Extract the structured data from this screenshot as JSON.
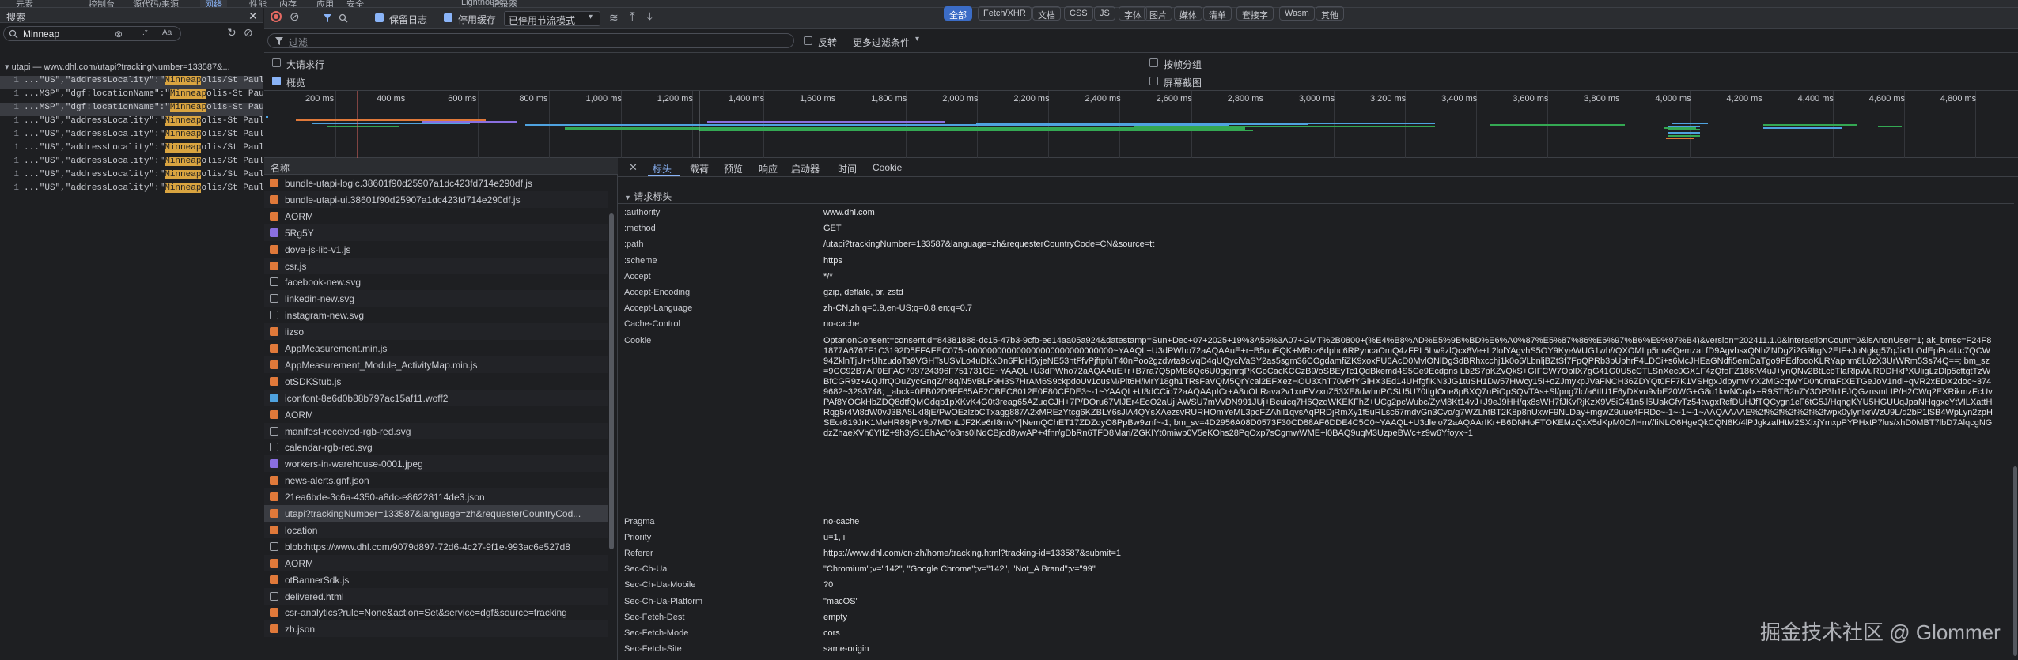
{
  "top_tabs": [
    "元素",
    "控制台",
    "源代码/来源",
    "网络",
    "性能",
    "内存",
    "应用",
    "安全",
    "Lighthouse",
    "记录器"
  ],
  "left_panel": {
    "title": "搜索",
    "query": "Minneap",
    "opts": [
      "Aa",
      ".*"
    ],
    "results_group": "utapi — www.dhl.com/utapi?trackingNumber=133587&...",
    "results": [
      {
        "n": "1",
        "pre": "...\"US\",\"addressLocality\":\"",
        "hl": "Minneap",
        "post": "olis/St Paul Apt\"},..."
      },
      {
        "n": "1",
        "pre": "...MSP\",\"dgf:locationName\":\"",
        "hl": "Minneap",
        "post": "olis-St Paul Int..."
      },
      {
        "n": "1",
        "pre": "...MSP\",\"dgf:locationName\":\"",
        "hl": "Minneap",
        "post": "olis-St Paul Int..."
      },
      {
        "n": "1",
        "pre": "...\"US\",\"addressLocality\":\"",
        "hl": "Minneap",
        "post": "olis-St Paul Inter..."
      },
      {
        "n": "1",
        "pre": "...\"US\",\"addressLocality\":\"",
        "hl": "Minneap",
        "post": "olis/St Paul Apt\"},..."
      },
      {
        "n": "1",
        "pre": "...\"US\",\"addressLocality\":\"",
        "hl": "Minneap",
        "post": "olis/St Paul Apt\"},..."
      },
      {
        "n": "1",
        "pre": "...\"US\",\"addressLocality\":\"",
        "hl": "Minneap",
        "post": "olis/St Paul Apt\"},..."
      },
      {
        "n": "1",
        "pre": "...\"US\",\"addressLocality\":\"",
        "hl": "Minneap",
        "post": "olis/St Paul Apt\"},..."
      },
      {
        "n": "1",
        "pre": "...\"US\",\"addressLocality\":\"",
        "hl": "Minneap",
        "post": "olis/St Paul Apt\"},..."
      }
    ]
  },
  "toolbar": {
    "preserve_log": "保留日志",
    "disable_cache": "停用缓存",
    "throttle": "已停用节流模式"
  },
  "filter": {
    "placeholder": "过滤",
    "invert": "反转",
    "more": "更多过滤条件",
    "types": [
      "全部",
      "Fetch/XHR",
      "文档",
      "CSS",
      "JS",
      "字体",
      "图片",
      "媒体",
      "清单",
      "套接字",
      "Wasm",
      "其他"
    ]
  },
  "options": {
    "big_rows": "大请求行",
    "overview": "概览",
    "group_by_frame": "按帧分组",
    "screenshots": "屏幕截图"
  },
  "timeline": {
    "ticks": [
      "200 ms",
      "400 ms",
      "600 ms",
      "800 ms",
      "1,000 ms",
      "1,200 ms",
      "1,400 ms",
      "1,600 ms",
      "1,800 ms",
      "2,000 ms",
      "2,200 ms",
      "2,400 ms",
      "2,600 ms",
      "2,800 ms",
      "3,000 ms",
      "3,200 ms",
      "3,400 ms",
      "3,600 ms",
      "3,800 ms",
      "4,000 ms",
      "4,200 ms",
      "4,400 ms",
      "4,600 ms",
      "4,800 ms"
    ]
  },
  "list_header": "名称",
  "requests": [
    {
      "name": "bundle-utapi-logic.38601f90d25907a1dc423fd714e290df.js",
      "type": "js"
    },
    {
      "name": "bundle-utapi-ui.38601f90d25907a1dc423fd714e290df.js",
      "type": "js"
    },
    {
      "name": "AORM",
      "type": "xhr"
    },
    {
      "name": "5Rg5Y",
      "type": "img"
    },
    {
      "name": "dove-js-lib-v1.js",
      "type": "js"
    },
    {
      "name": "csr.js",
      "type": "js"
    },
    {
      "name": "facebook-new.svg",
      "type": "svg"
    },
    {
      "name": "linkedin-new.svg",
      "type": "svg"
    },
    {
      "name": "instagram-new.svg",
      "type": "svg"
    },
    {
      "name": "iizso",
      "type": "js"
    },
    {
      "name": "AppMeasurement.min.js",
      "type": "js"
    },
    {
      "name": "AppMeasurement_Module_ActivityMap.min.js",
      "type": "js"
    },
    {
      "name": "otSDKStub.js",
      "type": "js"
    },
    {
      "name": "iconfont-8e6d0b88b797ac15af11.woff2",
      "type": "font"
    },
    {
      "name": "AORM",
      "type": "xhr"
    },
    {
      "name": "manifest-received-rgb-red.svg",
      "type": "svg"
    },
    {
      "name": "calendar-rgb-red.svg",
      "type": "svg"
    },
    {
      "name": "workers-in-warehouse-0001.jpeg",
      "type": "img"
    },
    {
      "name": "news-alerts.gnf.json",
      "type": "xhr"
    },
    {
      "name": "21ea6bde-3c6a-4350-a8dc-e86228114de3.json",
      "type": "xhr"
    },
    {
      "name": "utapi?trackingNumber=133587&language=zh&requesterCountryCod...",
      "type": "xhr"
    },
    {
      "name": "location",
      "type": "xhr"
    },
    {
      "name": "blob:https://www.dhl.com/9079d897-72d6-4c27-9f1e-993ac6e527d8",
      "type": "doc"
    },
    {
      "name": "AORM",
      "type": "xhr"
    },
    {
      "name": "otBannerSdk.js",
      "type": "js"
    },
    {
      "name": "delivered.html",
      "type": "doc"
    },
    {
      "name": "csr-analytics?rule=None&action=Set&service=dgf&source=tracking",
      "type": "xhr"
    },
    {
      "name": "zh.json",
      "type": "xhr"
    }
  ],
  "details": {
    "tabs": [
      "标头",
      "载荷",
      "预览",
      "响应",
      "启动器",
      "时间",
      "Cookie"
    ],
    "section": "请求标头",
    "headers": [
      {
        "k": ":authority",
        "v": "www.dhl.com"
      },
      {
        "k": ":method",
        "v": "GET"
      },
      {
        "k": ":path",
        "v": "/utapi?trackingNumber=133587&language=zh&requesterCountryCode=CN&source=tt"
      },
      {
        "k": ":scheme",
        "v": "https"
      },
      {
        "k": "Accept",
        "v": "*/*"
      },
      {
        "k": "Accept-Encoding",
        "v": "gzip, deflate, br, zstd"
      },
      {
        "k": "Accept-Language",
        "v": "zh-CN,zh;q=0.9,en-US;q=0.8,en;q=0.7"
      },
      {
        "k": "Cache-Control",
        "v": "no-cache"
      },
      {
        "k": "Cookie",
        "v": "OptanonConsent=consentId=84381888-dc15-47b3-9cfb-ee14aa05a924&datestamp=Sun+Dec+07+2025+19%3A56%3A07+GMT%2B0800+(%E4%B8%AD%E5%9B%BD%E6%A0%87%E5%87%86%E6%97%B6%E9%97%B4)&version=202411.1.0&interactionCount=0&isAnonUser=1; ak_bmsc=F24F81877A6767F1C3192D5FFAFEC075~000000000000000000000000000000~YAAQL+U3dPWho72aAQAAuE+r+B5ooFQK+MRcz6dphc6RPyncaOmQ4zFPL5Lw9zlQcx8Ve+L2lolYAgvhS5OY9KyeWUG1wh//QXOMLp5mv9QemzaLfD9AgvbsxQNhZNDgZi2G9bgN2EIF+JoNgkg57qJix1LOdEpPu4Uc7QCW94ZklnTjUr+fJhzudoTa9VGHTsUSVLo4uDKxDn6FldH5yjeNE53ntFfvPjftpfuT40nPoo2gzdwta9cVqD4qUQyciVaSY2as5sgm36COgdamfiZK9xoxFU6AcD0MvlONlDgSdBRhxcchj1k0o6/LbnljBZtSf7FpQPRb3pUbhrF4LDCi+s6McJHEaGNdfi5emDaTgo9FEdfoooKLRYapnm8L0zX3UrWRm5Ss74Q==; bm_sz=9CC92B7AF0EFAC709724396F751731CE~YAAQL+U3dPWho72aAQAAuE+r+B7ra7Q5pMB6Qc6U0gcjnrqPKGoCacKCCzB9/oSBEyTc1QdBkemd4S5Ce9Ecdpns Lb2S7pKZvQkS+GIFCW7OpllX7gG41G0U5cCTLSnXec0GX1F4zQfoFZ186tV4uJ+ynQNv2BtLcbTlaRlpWuRDDHkPXUligLzDlp5cftgtTzWBfCGR9z+AQJfrQOuZycGnqZ/h8q/N5vBLP9H3S7HrAM6S9ckpdoUv1ousM/Plt6H/MrY18gh1TRsFaVQM5QrYcal2EFXezHOU3XhT70vPfYGiHX3Ed14UHfgfiKN3JG1tuSH1Dw57HWcy15I+oZJmykpJVaFNCH36ZDYQt0FF7K1VSHgxJdpymVYX2MGcqWYD0h0maFtXETGeJoV1ndi+qVR2xEDX2doc~3749682~3293748; _abck=0EB02D8FF65AF2CBEC8012E0F80CFDE3~-1~YAAQL+U3dCCio72aAQAApICr+A8uOLRava2v1xnFVzxnZ53XE8dwhnPCSU5U70tlgIOne8pBXQ7uPiOpSQVTAs+Sl/png7lc/a6tlU1F6yDKvu9vbE20WG+G8u1kwNCq4x+R9STB2n7Y3OP3h1FJQGznsmLIP/H2CWq2EXRikmzFcUvPAf8YOGkHbZDQ8dtfQMGdqb1pXKvK4G0t3reag65AZuqCJH+7P/DOru67VIJEr4EoO2aUjIAWSU7mVvDN991JUj+Bcuicq7H6QzqWKEKFhZ+UCg2pcWubc/ZyM8Kt14vJ+J9eJ9HH/qx8sWH7fJKvRjKzX9V5iG41n5il5UakGfvTz54twgxRcfDUHJfTQCygn1cF6tG5J/HqngKYU5HGUUqJpaNHqgxcYtVILXattHRqg5r4Vi8dW0vJ3BA5LkI8jE/PwOEzlzbCTxagg887A2xMREzYtcg6KZBLY6sJlA4QYsXAezsvRURHOmYeML3pcFZAhil1qvsAqPRDjRmXy1f5uRLsc67mdvGn3Cvo/g7WZLhtBT2K8p8nUxwF9NLDay+mgwZ9uue4FRDc~-1~-1~-1~AAQAAAAE%2f%2f%2f%2f%2fwpx0ylynlxrWzU9L/d2bP1lSB4WpLyn2zpHSEor819JrK1MeHR89jPY9p7MDnLJF2Ke6rI8mVY|NemQChET17ZDZdyO8PpBw9znf~-1; bm_sv=4D2956A08D0573F30CD88AF6DDE4C5C0~YAAQL+U3dleio72aAQAArIKr+B6DNHoFTOKEMzQxX5dKpM0D/IHm//fiNLO6HgeQkCQN8K/4lPJgkzafHtM2SXixjYmxpPYPHxtP7lus/xhD0MBT7lbD7AlqcgNGdzZhaeXVh6YIfZ+9h3yS1EhAcYo8ns0lNdCBjod8ywAP+4fnr/gDbRn6TFD8Mari/ZGKIYt0miwb0V5eKOhs28PqOxp7sCgmwWME+l0BAQ9uqM3UzpeBWc+z9w6Yfoyx~1"
      },
      {
        "k": "Pragma",
        "v": "no-cache"
      },
      {
        "k": "Priority",
        "v": "u=1, i"
      },
      {
        "k": "Referer",
        "v": "https://www.dhl.com/cn-zh/home/tracking.html?tracking-id=133587&submit=1"
      },
      {
        "k": "Sec-Ch-Ua",
        "v": "\"Chromium\";v=\"142\", \"Google Chrome\";v=\"142\", \"Not_A Brand\";v=\"99\""
      },
      {
        "k": "Sec-Ch-Ua-Mobile",
        "v": "?0"
      },
      {
        "k": "Sec-Ch-Ua-Platform",
        "v": "\"macOS\""
      },
      {
        "k": "Sec-Fetch-Dest",
        "v": "empty"
      },
      {
        "k": "Sec-Fetch-Mode",
        "v": "cors"
      },
      {
        "k": "Sec-Fetch-Site",
        "v": "same-origin"
      }
    ]
  },
  "watermark": "掘金技术社区 @ Glommer",
  "colors": {
    "accent": "#8ab4f8",
    "highlight": "#d9a440",
    "selected_row": "#3a3c42",
    "js": "#e0793a",
    "xhr": "#e0793a",
    "img": "#8a6fe0",
    "svg": "#a0a4ab",
    "font": "#4fa3e0",
    "doc": "#a0a4ab"
  }
}
